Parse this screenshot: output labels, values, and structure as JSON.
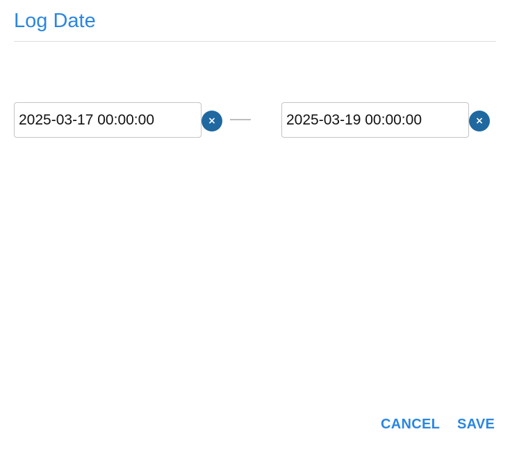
{
  "dialog": {
    "title": "Log Date"
  },
  "range": {
    "start_value": "2025-03-17 00:00:00",
    "end_value": "2025-03-19 00:00:00",
    "clear_glyph": "×"
  },
  "actions": {
    "cancel_label": "CANCEL",
    "save_label": "SAVE"
  },
  "colors": {
    "accent": "#2a86e0",
    "clear_button": "#2068a0",
    "border": "#c4c4c4",
    "divider": "#dddddd"
  },
  "icons": {
    "clear": "close-icon",
    "separator": "range-dash"
  }
}
